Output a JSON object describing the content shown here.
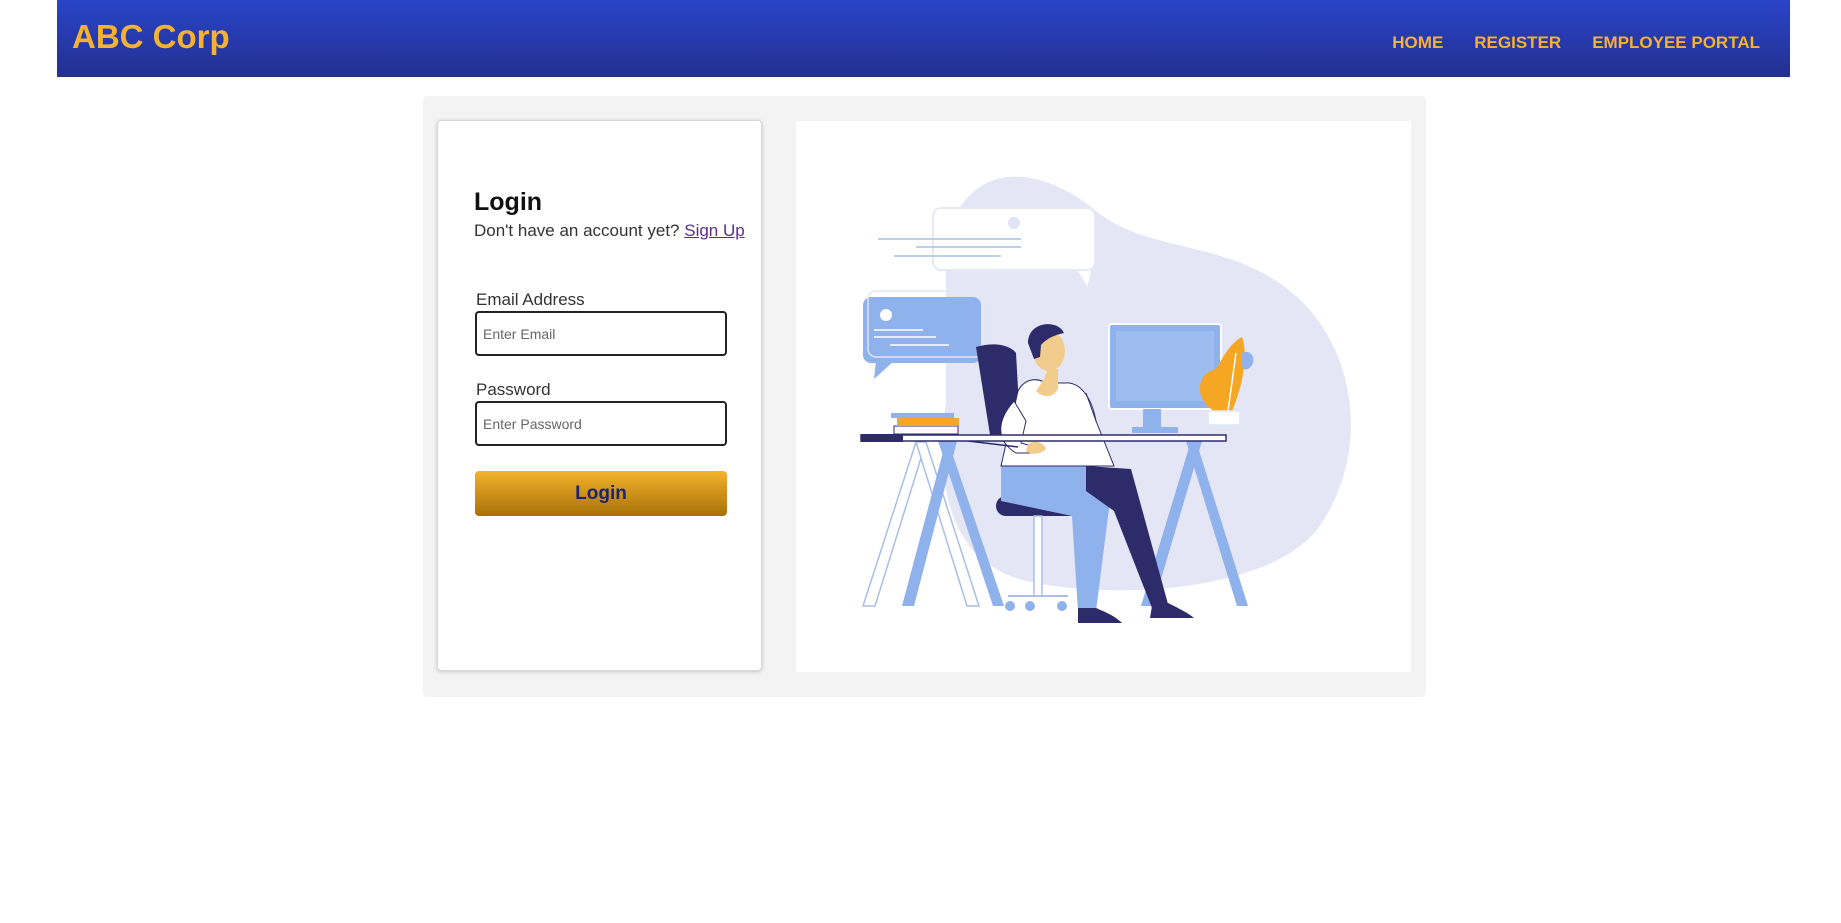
{
  "navbar": {
    "brand": "ABC Corp",
    "links": [
      {
        "label": "HOME"
      },
      {
        "label": "REGISTER"
      },
      {
        "label": "EMPLOYEE PORTAL"
      }
    ]
  },
  "login": {
    "title": "Login",
    "signup_prompt": "Don't have an account yet?",
    "signup_link": "Sign Up",
    "email": {
      "label": "Email Address",
      "placeholder": "Enter Email",
      "value": ""
    },
    "password": {
      "label": "Password",
      "placeholder": "Enter Password",
      "value": ""
    },
    "submit_label": "Login"
  },
  "colors": {
    "navbar_top": "#2a44c9",
    "navbar_bottom": "#22308f",
    "accent_gold": "#f5b132",
    "button_text": "#1b2473",
    "link_purple": "#5b2d91",
    "illustration_blue": "#8fb1ec",
    "illustration_navy": "#2e2b6b"
  },
  "illustration": {
    "icon": "office-worker-at-desk-illustration"
  }
}
